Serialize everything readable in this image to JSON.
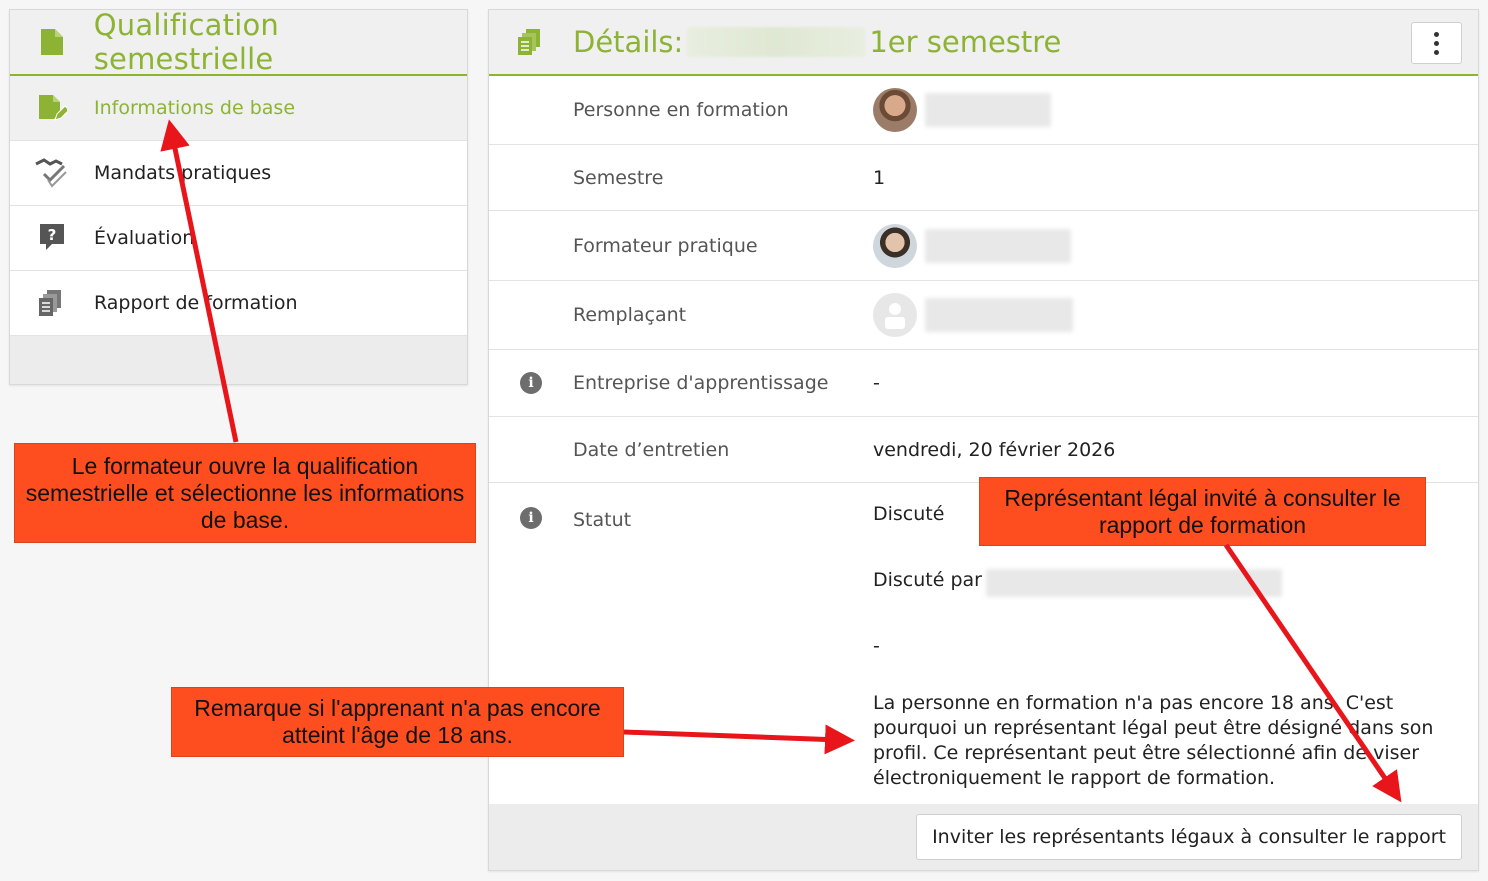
{
  "left_panel": {
    "title": "Qualification semestrielle",
    "title_icon": "document-icon",
    "items": [
      {
        "label": "Informations de base",
        "icon": "document-edit-icon",
        "active": true
      },
      {
        "label": "Mandats pratiques",
        "icon": "handshake-check-icon",
        "active": false
      },
      {
        "label": "Évaluation",
        "icon": "question-bubble-icon",
        "active": false
      },
      {
        "label": "Rapport de formation",
        "icon": "documents-icon",
        "active": false
      }
    ]
  },
  "details": {
    "title_prefix": "Détails:",
    "title_suffix": "1er semestre",
    "title_icon": "documents-icon",
    "menu_icon": "kebab-menu-icon",
    "rows": {
      "trainee": {
        "label": "Personne en formation"
      },
      "semester": {
        "label": "Semestre",
        "value": "1"
      },
      "trainer": {
        "label": "Formateur pratique"
      },
      "substitute": {
        "label": "Remplaçant"
      },
      "company": {
        "label": "Entreprise d'apprentissage",
        "value": "-"
      },
      "interview_date": {
        "label": "Date d’entretien",
        "value": "vendredi, 20 février 2026"
      },
      "status": {
        "label": "Statut",
        "value": "Discuté",
        "discussed_by": "Discuté par",
        "dash": "-",
        "note": "La personne en formation n'a pas encore 18 ans. C'est pourquoi un représentant légal peut être désigné dans son profil. Ce représentant peut être sélectionné afin de viser électroniquement le rapport de formation."
      }
    },
    "footer_button": "Inviter les représentants légaux à consulter le rapport"
  },
  "annotations": {
    "callout_1": "Le formateur ouvre la qualification semestrielle et sélectionne les informations de base.",
    "callout_2": "Représentant légal invité à consulter le rapport de formation",
    "callout_3": "Remarque si l'apprenant n'a pas encore atteint l'âge de 18 ans.",
    "color": "#fe4e1f",
    "arrow_color": "#e8161b"
  },
  "colors": {
    "accent": "#8db334"
  }
}
